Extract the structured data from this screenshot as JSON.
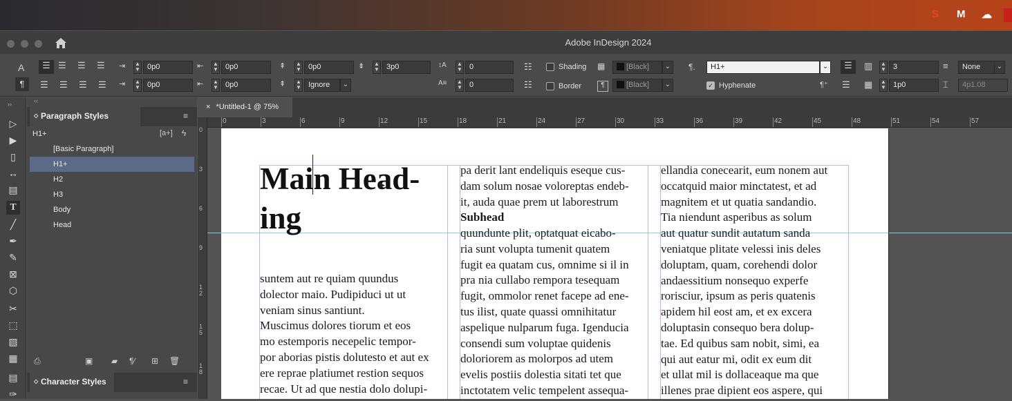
{
  "app": {
    "title": "Adobe InDesign 2024"
  },
  "control": {
    "left_indent": "0p0",
    "first_line": "0p0",
    "right_indent": "0p0",
    "last_line": "0p0",
    "space_before": "0p0",
    "space_after": "3p0",
    "grid_align": "Ignore",
    "drop_cap_lines": "0",
    "drop_cap_chars": "0",
    "shading_label": "Shading",
    "border_label": "Border",
    "shading_color": "[Black]",
    "border_color": "[Black]",
    "para_style": "H1+",
    "hyphenate_label": "Hyphenate",
    "columns": "3",
    "gutter": "1p0",
    "span": "None",
    "width": "4p1.08"
  },
  "paragraph_styles": {
    "title": "Paragraph Styles",
    "current": "H1+",
    "items": [
      "[Basic Paragraph]",
      "H1+",
      "H2",
      "H3",
      "Body",
      "Head"
    ],
    "selected_index": 1
  },
  "character_styles": {
    "title": "Character Styles"
  },
  "document": {
    "tab": "*Untitled-1 @ 75%",
    "ruler_h": [
      "0",
      "3",
      "6",
      "9",
      "12",
      "15",
      "18",
      "21",
      "24",
      "27",
      "30",
      "33",
      "36",
      "39",
      "42",
      "45",
      "48",
      "51",
      "54",
      "57"
    ],
    "ruler_v": [
      "0",
      "3",
      "6",
      "9",
      "1\n2",
      "1\n5",
      "1\n8"
    ],
    "heading": "Main Head-\ning",
    "col1": "suntem aut re quiam quundus\ndolector maio. Pudipiduci ut ut\nveniam sinus santiunt.\nMuscimus dolores tiorum et eos\nmo estemporis necepelic tempor-\npor aborias pistis dolutesto et aut ex\nere reprae platiumet restion sequos\nrecae. Ut ad que nestia dolo dolupi-",
    "col2_top": "pa derit lant endeliquis eseque cus-\ndam solum nosae voloreptas endeb-\nit, auda quae prem ut laborestrum",
    "subhead": "Subhead",
    "col2_body": "quundunte plit, optatquat eicabo-\nria sunt volupta tumenit quatem\nfugit ea quatam cus, omnime si il in\npra nia cullabo rempora tesequam\nfugit, ommolor renet facepe ad ene-\ntus ilist, quate quassi omnihitatur\naspelique nulparum fuga. Igenducia\nconsendi sum voluptae quidenis\ndoloriorem as molorpos ad utem\nevelis postiis dolestia sitati tet que\ninctotatem velic tempelent assequa-",
    "col3": "ellandia conecearit, eum nonem aut\noccatquid maior minctatest, et ad\nmagnitem et ut quatia sandandio.\nTia niendunt asperibus as solum\naut quatur sundit autatum sanda\nveniatque plitate velessi inis deles\ndoluptam, quam, corehendi dolor\nandaessitium nonsequo experfe\nrorisciur, ipsum as peris quatenis\napidem hil eost am, et ex excera\ndoluptasin consequo bera dolup-\ntae. Ed quibus sam nobit, simi, ea\nqui aut eatur mi, odit ex eum dit\net ullat mil is dollaceaque ma que\nillenes prae dipient eos aspere, qui"
  },
  "colors": {
    "selection": "#5a6a88",
    "frame": "#cf8fe0",
    "guide": "#7fd7e6"
  }
}
